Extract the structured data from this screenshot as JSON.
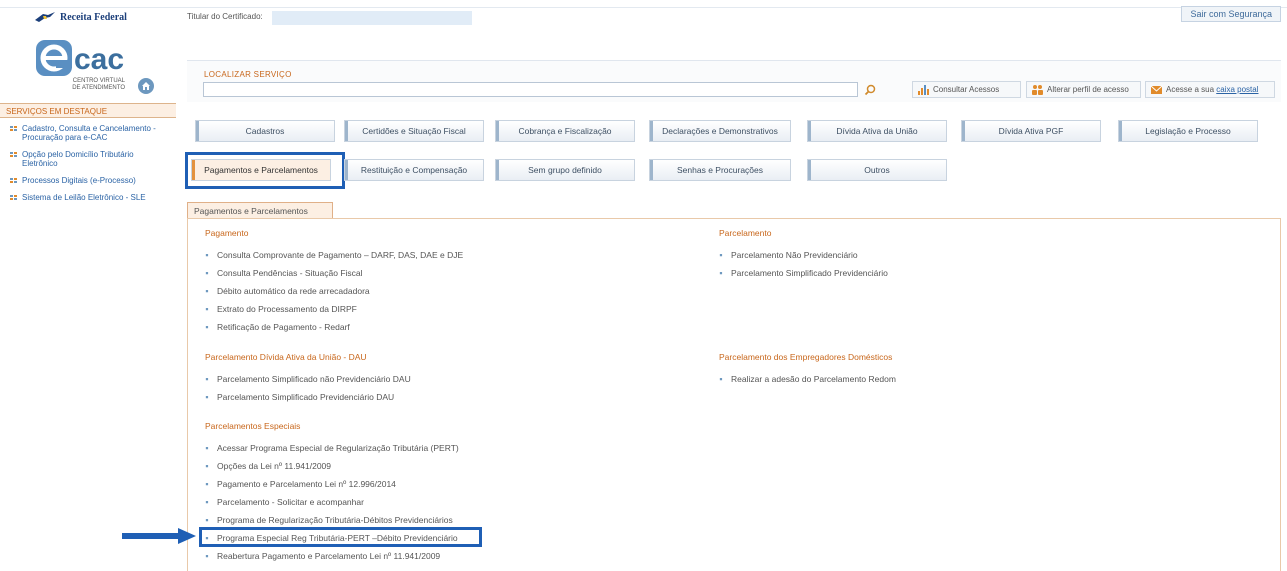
{
  "header": {
    "brand": "Receita Federal",
    "certificate_label": "Titular do Certificado: ",
    "logout_label": "Sair com Segurança"
  },
  "logo": {
    "name": "ecac",
    "sub1": "CENTRO VIRTUAL",
    "sub2": "DE ATENDIMENTO"
  },
  "search": {
    "label": "LOCALIZAR SERVIÇO",
    "value": "",
    "placeholder": ""
  },
  "quick_links": [
    {
      "label": "Consultar Acessos",
      "icon": "access-chart-icon"
    },
    {
      "label": "Alterar perfil de acesso",
      "icon": "people-icon"
    },
    {
      "label": "Acesse a sua ",
      "underlined": "caixa postal",
      "icon": "mail-icon"
    }
  ],
  "sidebar": {
    "title": "SERVIÇOS EM DESTAQUE",
    "items": [
      {
        "label": "Cadastro, Consulta e Cancelamento - Procuração para e-CAC"
      },
      {
        "label": "Opção pelo Domicílio Tributário Eletrônico"
      },
      {
        "label": "Processos Digitais (e-Processo)"
      },
      {
        "label": "Sistema de Leilão Eletrônico - SLE"
      }
    ]
  },
  "categories": {
    "row1": [
      "Cadastros",
      "Certidões e Situação Fiscal",
      "Cobrança e Fiscalização",
      "Declarações e Demonstrativos",
      "Dívida Ativa da União",
      "Dívida Ativa PGF",
      "Legislação e Processo"
    ],
    "row2": [
      "Pagamentos e Parcelamentos",
      "Restituição e Compensação",
      "Sem grupo definido",
      "Senhas e Procurações",
      "Outros"
    ]
  },
  "active_tab": "Pagamentos e Parcelamentos",
  "sections": {
    "pagamento": {
      "title": "Pagamento",
      "items": [
        "Consulta Comprovante de Pagamento – DARF, DAS, DAE e DJE",
        "Consulta Pendências - Situação Fiscal",
        "Débito automático da rede arrecadadora",
        "Extrato do Processamento da DIRPF",
        "Retificação de Pagamento - Redarf"
      ]
    },
    "parcelamento": {
      "title": "Parcelamento",
      "items": [
        "Parcelamento Não Previdenciário",
        "Parcelamento Simplificado Previdenciário"
      ]
    },
    "dau": {
      "title": "Parcelamento Dívida Ativa da União - DAU",
      "items": [
        "Parcelamento Simplificado não Previdenciário DAU",
        "Parcelamento Simplificado Previdenciário DAU"
      ]
    },
    "domesticos": {
      "title": "Parcelamento dos Empregadores Domésticos",
      "items": [
        "Realizar a adesão do Parcelamento Redom"
      ]
    },
    "especiais": {
      "title": "Parcelamentos Especiais",
      "items": [
        "Acessar Programa Especial de Regularização Tributária (PERT)",
        "Opções da Lei nº 11.941/2009",
        "Pagamento e Parcelamento Lei nº 12.996/2014",
        "Parcelamento - Solicitar e acompanhar",
        "Programa de Regularização Tributária-Débitos Previdenciários",
        "Programa Especial Reg Tributária-PERT –Débito Previdenciário",
        "Reabertura Pagamento e Parcelamento Lei nº 11.941/2009"
      ]
    }
  },
  "colors": {
    "accent_orange": "#c8671c",
    "link_blue": "#2b63a5",
    "highlight_blue": "#1f5fb5"
  }
}
